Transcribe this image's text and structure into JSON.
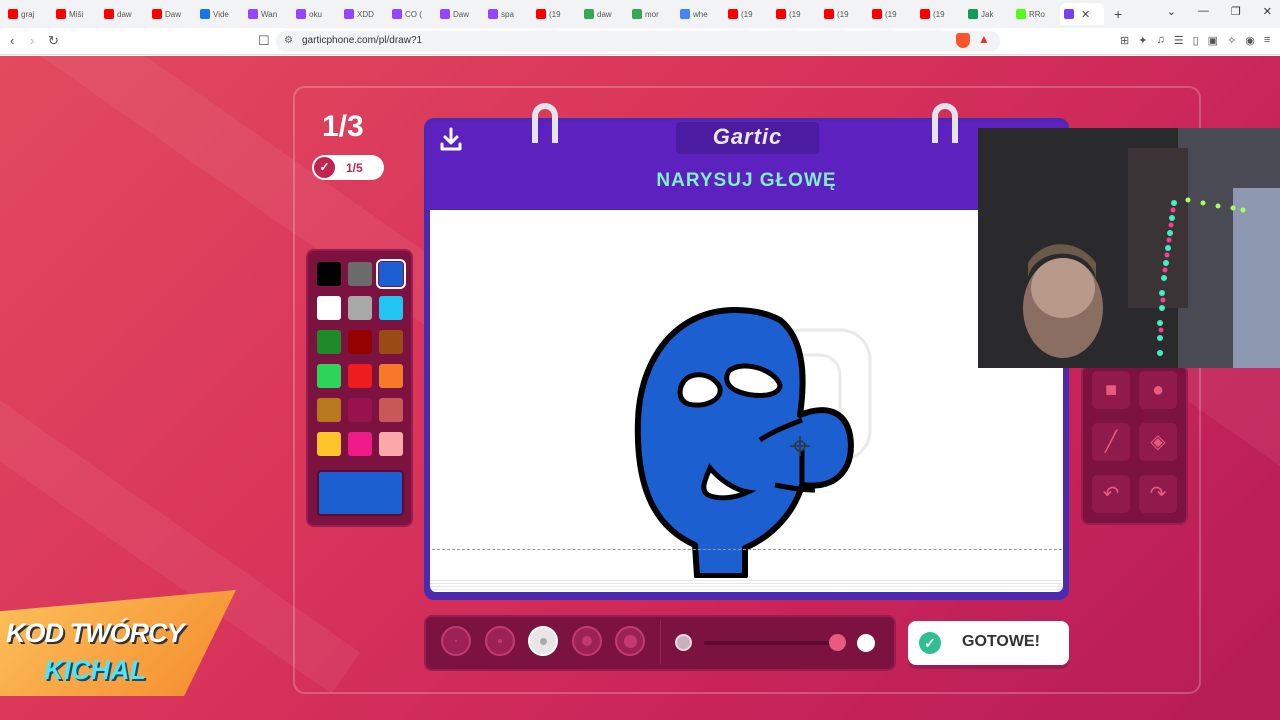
{
  "browser": {
    "tabs": [
      {
        "label": "graj",
        "color": "#ff0000"
      },
      {
        "label": "Miši",
        "color": "#ff0000"
      },
      {
        "label": "daw",
        "color": "#ff0000"
      },
      {
        "label": "Daw",
        "color": "#ff0000"
      },
      {
        "label": "Vide",
        "color": "#1a73e8"
      },
      {
        "label": "Wan",
        "color": "#9146ff"
      },
      {
        "label": "oku",
        "color": "#9146ff"
      },
      {
        "label": "XDD",
        "color": "#9146ff"
      },
      {
        "label": "CO (",
        "color": "#9146ff"
      },
      {
        "label": "Daw",
        "color": "#9146ff"
      },
      {
        "label": "spa",
        "color": "#9146ff"
      },
      {
        "label": "(19",
        "color": "#ff0000"
      },
      {
        "label": "daw",
        "color": "#34a853"
      },
      {
        "label": "mor",
        "color": "#34a853"
      },
      {
        "label": "whe",
        "color": "#4285f4"
      },
      {
        "label": "(19",
        "color": "#ff0000"
      },
      {
        "label": "(19",
        "color": "#ff0000"
      },
      {
        "label": "(19",
        "color": "#ff0000"
      },
      {
        "label": "(19",
        "color": "#ff0000"
      },
      {
        "label": "(19",
        "color": "#ff0000"
      },
      {
        "label": "Jak",
        "color": "#0f9d58"
      },
      {
        "label": "RRo",
        "color": "#53fc18"
      }
    ],
    "active_tab_color": "#7b3ff2",
    "url": "garticphone.com/pl/draw?1"
  },
  "game": {
    "round": "1/3",
    "progress": "1/5",
    "logo": "Gartic",
    "prompt": "NARYSUJ GŁOWĘ",
    "done_label": "GOTOWE!",
    "selected_color": "#1c5fd0",
    "palette": [
      "#000000",
      "#6b6b6b",
      "#1c5fd0",
      "#ffffff",
      "#a8a8a8",
      "#22c4f4",
      "#1e8a2a",
      "#950000",
      "#9a4a14",
      "#2dd45a",
      "#ee1c1c",
      "#f7782a",
      "#b8781e",
      "#99124e",
      "#c85858",
      "#fcc42a",
      "#ee1a88",
      "#fca8a8"
    ],
    "tools": [
      {
        "name": "square-tool-icon",
        "glyph": "■"
      },
      {
        "name": "ellipse-tool-icon",
        "glyph": "●"
      },
      {
        "name": "line-tool-icon",
        "glyph": "╱"
      },
      {
        "name": "fill-bucket-icon",
        "glyph": "◈"
      },
      {
        "name": "undo-icon",
        "glyph": "↶"
      },
      {
        "name": "redo-icon",
        "glyph": "↷"
      }
    ],
    "brush_sizes": 5,
    "selected_brush": 3
  },
  "banner": {
    "line1": "KOD TWÓRCY",
    "line2": "KICHAL"
  }
}
